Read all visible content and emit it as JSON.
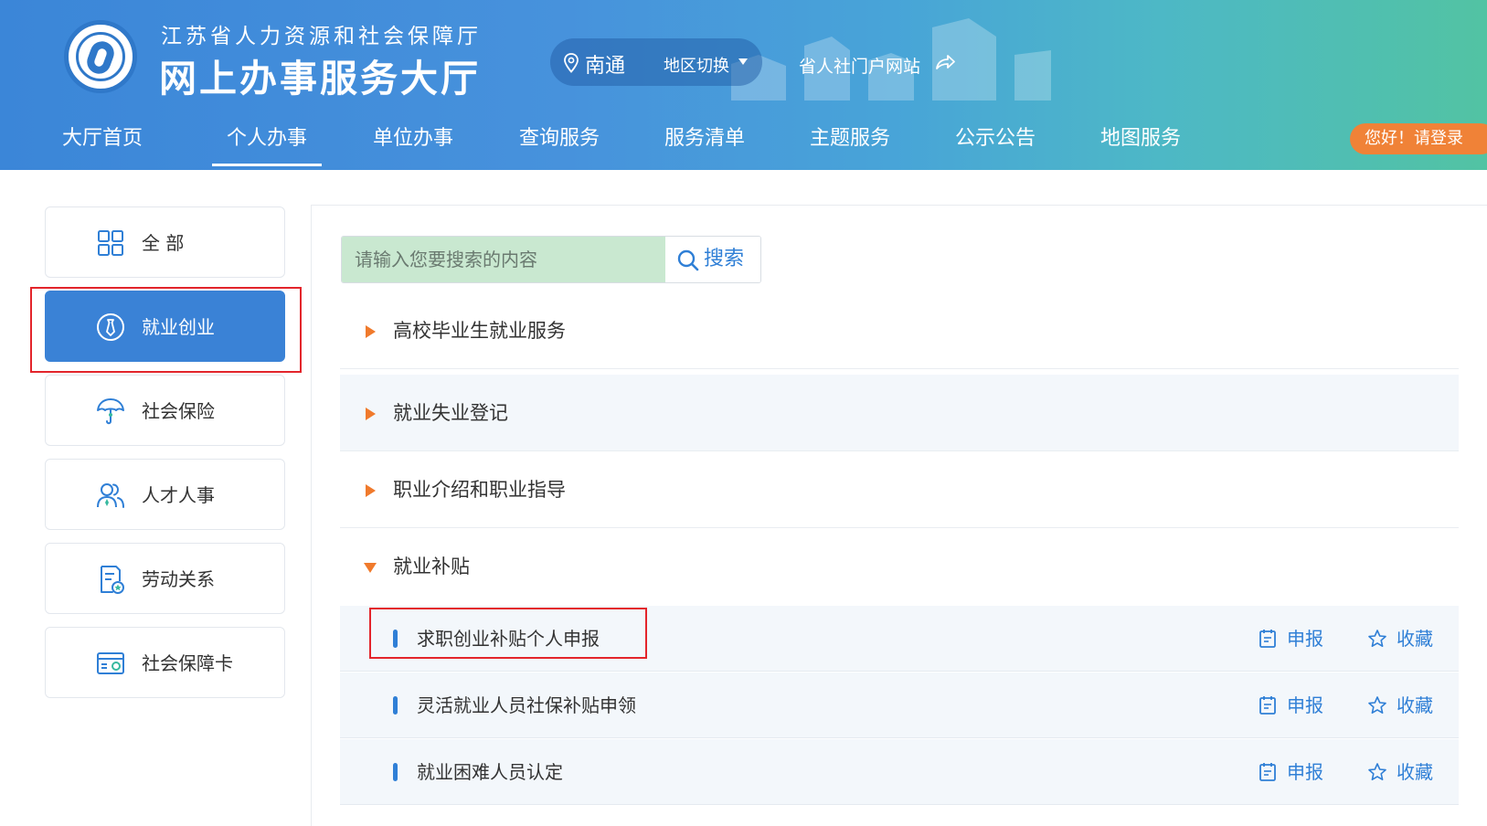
{
  "header": {
    "org_subtitle": "江苏省人力资源和社会保障厅",
    "org_title": "网上办事服务大厅",
    "region": {
      "name": "南通",
      "switch_label": "地区切换"
    },
    "portal_link": "省人社门户网站",
    "login_label": "您好！请登录",
    "nav": [
      {
        "label": "大厅首页"
      },
      {
        "label": "个人办事",
        "active": true
      },
      {
        "label": "单位办事"
      },
      {
        "label": "查询服务"
      },
      {
        "label": "服务清单"
      },
      {
        "label": "主题服务"
      },
      {
        "label": "公示公告"
      },
      {
        "label": "地图服务"
      }
    ]
  },
  "sidebar": {
    "items": [
      {
        "label": "全 部",
        "icon": "grid-icon"
      },
      {
        "label": "就业创业",
        "icon": "tie-icon",
        "active": true
      },
      {
        "label": "社会保险",
        "icon": "umbrella-icon"
      },
      {
        "label": "人才人事",
        "icon": "people-icon"
      },
      {
        "label": "劳动关系",
        "icon": "document-icon"
      },
      {
        "label": "社会保障卡",
        "icon": "card-icon"
      }
    ]
  },
  "search": {
    "placeholder": "请输入您要搜索的内容",
    "button_label": "搜索"
  },
  "categories": [
    {
      "label": "高校毕业生就业服务",
      "expanded": false
    },
    {
      "label": "就业失业登记",
      "expanded": false
    },
    {
      "label": "职业介绍和职业指导",
      "expanded": false
    },
    {
      "label": "就业补贴",
      "expanded": true
    }
  ],
  "services": [
    {
      "label": "求职创业补贴个人申报",
      "apply_label": "申报",
      "favorite_label": "收藏"
    },
    {
      "label": "灵活就业人员社保补贴申领",
      "apply_label": "申报",
      "favorite_label": "收藏"
    },
    {
      "label": "就业困难人员认定",
      "apply_label": "申报",
      "favorite_label": "收藏"
    }
  ],
  "colors": {
    "accent_blue": "#3a82d6",
    "accent_orange": "#f08237",
    "highlight_red": "#e3252b",
    "search_bg": "#c9e8d0"
  }
}
